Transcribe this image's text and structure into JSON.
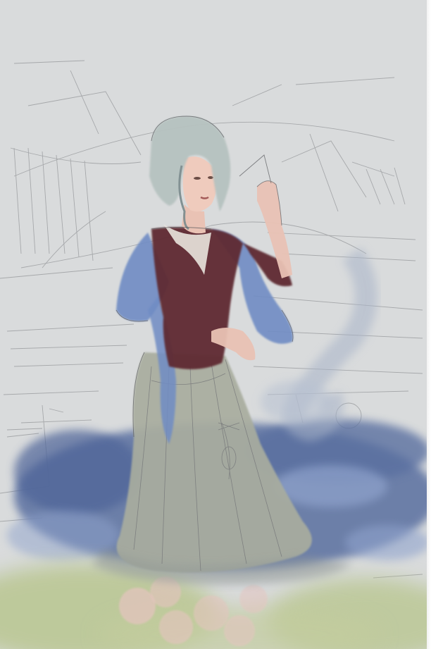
{
  "artwork": {
    "subject": "sketch-figure-woman-in-gown",
    "colors": {
      "paper": "#d9dbdc",
      "pencil": "#6e6f73",
      "hair": "#b6c2c0",
      "skin": "#e9c2b4",
      "bodice": "#5e2a33",
      "sleeves": "#6f8cc4",
      "skirt": "#a9ad9f",
      "water_dark": "#5a6fa0",
      "water_light": "#8fa3cc",
      "grass": "#b9c690",
      "blossom": "#e6c4c0"
    }
  }
}
